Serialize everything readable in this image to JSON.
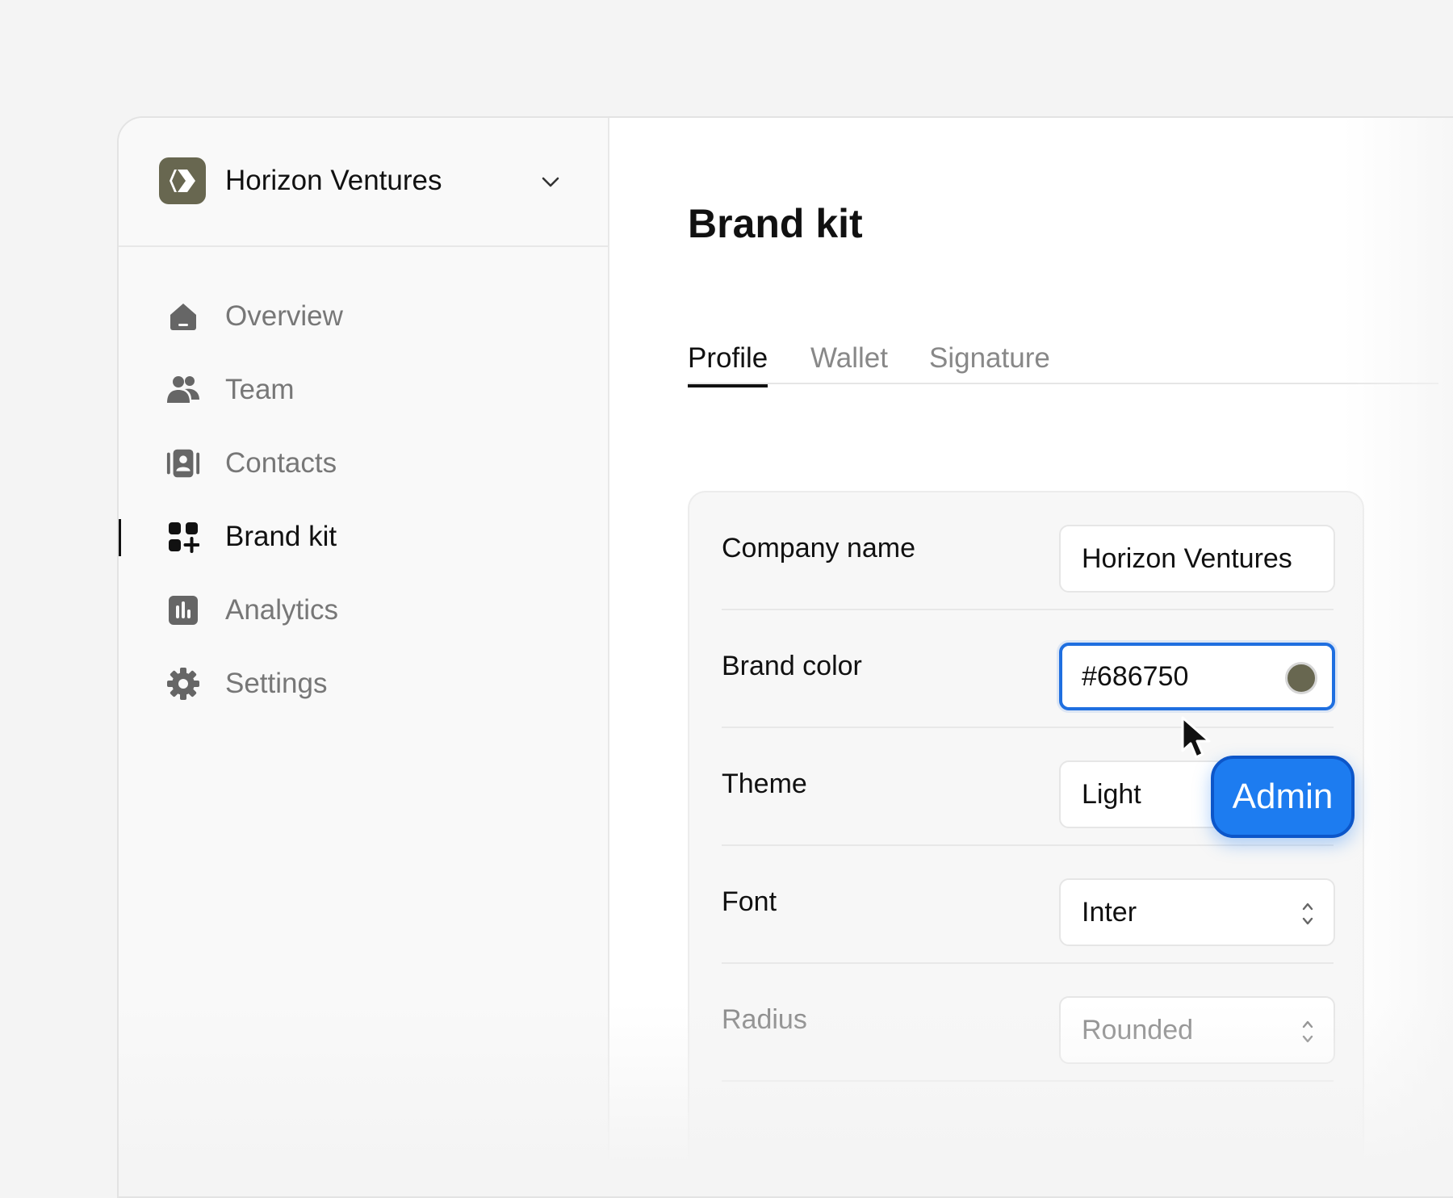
{
  "workspace": {
    "name": "Horizon Ventures",
    "logo_color": "#686750"
  },
  "nav": {
    "items": [
      {
        "label": "Overview",
        "icon": "home-icon"
      },
      {
        "label": "Team",
        "icon": "people-icon"
      },
      {
        "label": "Contacts",
        "icon": "contacts-icon"
      },
      {
        "label": "Brand kit",
        "icon": "brand-kit-icon",
        "active": true
      },
      {
        "label": "Analytics",
        "icon": "analytics-icon"
      },
      {
        "label": "Settings",
        "icon": "gear-icon"
      }
    ]
  },
  "page": {
    "title": "Brand kit"
  },
  "tabs": [
    {
      "label": "Profile",
      "active": true
    },
    {
      "label": "Wallet"
    },
    {
      "label": "Signature"
    }
  ],
  "form": {
    "company_name": {
      "label": "Company name",
      "value": "Horizon Ventures"
    },
    "brand_color": {
      "label": "Brand color",
      "value": "#686750",
      "swatch": "#686750"
    },
    "theme": {
      "label": "Theme",
      "value": "Light"
    },
    "font": {
      "label": "Font",
      "value": "Inter"
    },
    "radius": {
      "label": "Radius",
      "value": "Rounded"
    }
  },
  "badge": {
    "label": "Admin",
    "color": "#1d7cf0"
  },
  "colors": {
    "accent": "#1f6fe0",
    "brand": "#686750"
  }
}
